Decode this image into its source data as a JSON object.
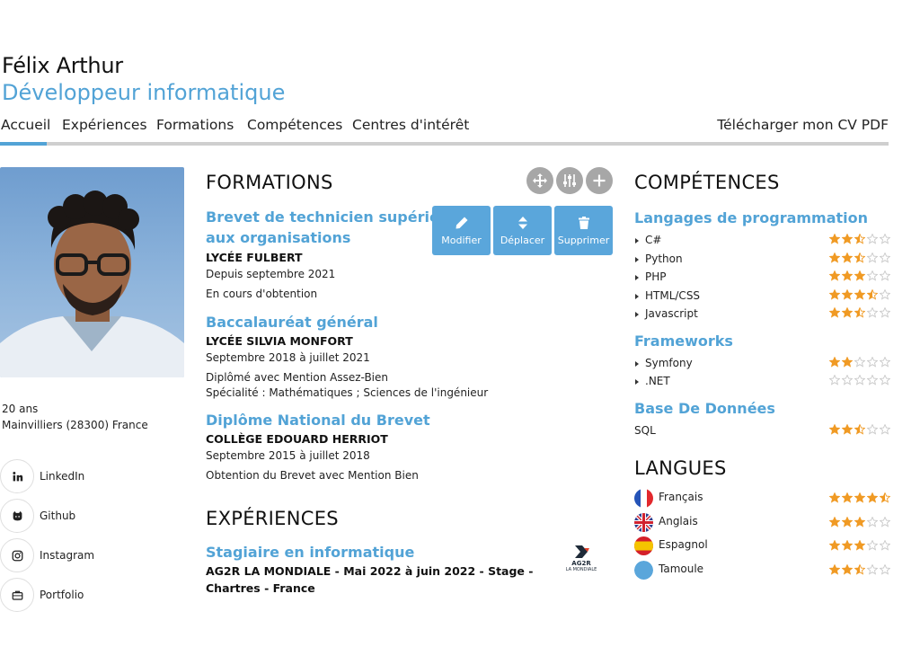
{
  "header": {
    "name": "Félix Arthur",
    "title": "Développeur informatique"
  },
  "nav": {
    "items": [
      "Accueil",
      "Expériences",
      "Formations",
      "Compétences",
      "Centres d'intérêt"
    ],
    "download": "Télécharger mon CV PDF",
    "active": "Accueil"
  },
  "profile": {
    "age": "20 ans",
    "location": "Mainvilliers (28300) France",
    "social": [
      {
        "label": "LinkedIn",
        "icon": "linkedin-icon"
      },
      {
        "label": "Github",
        "icon": "github-icon"
      },
      {
        "label": "Instagram",
        "icon": "instagram-icon"
      },
      {
        "label": "Portfolio",
        "icon": "portfolio-icon"
      }
    ]
  },
  "formations": {
    "title": "FORMATIONS",
    "items": [
      {
        "title_1": "Brevet de technicien supérieur",
        "title_2": "aux organisations",
        "org": "LYCÉE FULBERT",
        "dates": "Depuis septembre 2021",
        "details": [
          "En cours d'obtention"
        ]
      },
      {
        "title_1": "Baccalauréat général",
        "title_2": "",
        "org": "LYCÉE SILVIA MONFORT",
        "dates": "Septembre 2018 à juillet 2021",
        "details": [
          "Diplômé avec Mention Assez-Bien",
          "Spécialité : Mathématiques ; Sciences de l'ingénieur"
        ]
      },
      {
        "title_1": "Diplôme National du Brevet",
        "title_2": "",
        "org": "COLLÈGE EDOUARD HERRIOT",
        "dates": "Septembre 2015 à juillet 2018",
        "details": [
          "Obtention du Brevet avec Mention Bien"
        ]
      }
    ]
  },
  "edit_tools": {
    "modify": "Modifier",
    "move": "Déplacer",
    "delete": "Supprimer"
  },
  "experiences": {
    "title": "EXPÉRIENCES",
    "items": [
      {
        "title": "Stagiaire en informatique",
        "org_1": "AG2R LA MONDIALE - Mai 2022 à juin 2022 - Stage -",
        "org_2": "Chartres - France",
        "logo_1": "AG2R",
        "logo_2": "LA MONDIALE"
      }
    ]
  },
  "competences": {
    "title": "COMPÉTENCES",
    "groups": [
      {
        "name": "Langages de programmation",
        "bullets": true,
        "skills": [
          {
            "name": "C#",
            "rating": 2.5
          },
          {
            "name": "Python",
            "rating": 2.5
          },
          {
            "name": "PHP",
            "rating": 3
          },
          {
            "name": "HTML/CSS",
            "rating": 3.5
          },
          {
            "name": "Javascript",
            "rating": 2.5
          }
        ]
      },
      {
        "name": "Frameworks",
        "bullets": true,
        "skills": [
          {
            "name": "Symfony",
            "rating": 2
          },
          {
            "name": ".NET",
            "rating": 0
          }
        ]
      },
      {
        "name": "Base De Données",
        "bullets": false,
        "skills": [
          {
            "name": "SQL",
            "rating": 2.5
          }
        ]
      }
    ]
  },
  "langues": {
    "title": "LANGUES",
    "items": [
      {
        "name": "Français",
        "rating": 4.5,
        "flag": "fr"
      },
      {
        "name": "Anglais",
        "rating": 3,
        "flag": "uk"
      },
      {
        "name": "Espagnol",
        "rating": 3,
        "flag": "es"
      },
      {
        "name": "Tamoule",
        "rating": 2.5,
        "flag": "none"
      }
    ]
  },
  "colors": {
    "accent": "#52a3d6",
    "star": "#f09a24",
    "star_empty": "#c9c9c9",
    "edit_button": "#5aa6db",
    "tool_circle": "#a7a7a7"
  }
}
